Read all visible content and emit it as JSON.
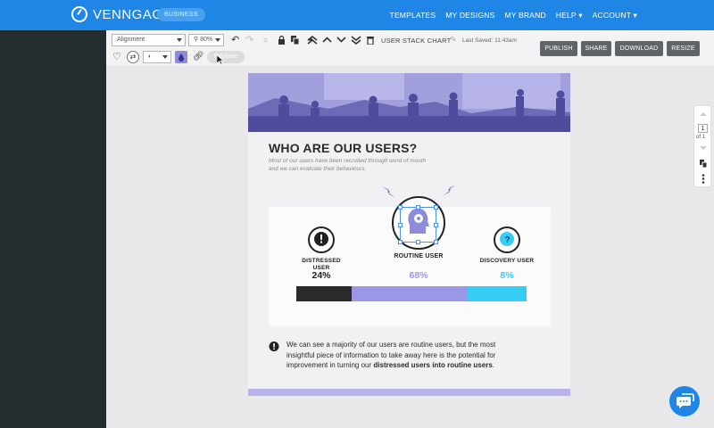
{
  "app": {
    "logo_text": "VENNGAGE",
    "plan_badge": "BUSINESS",
    "nav": [
      "TEMPLATES",
      "MY DESIGNS",
      "MY BRAND",
      "HELP ▾",
      "ACCOUNT ▾"
    ]
  },
  "toolbar": {
    "alignment_value": "Alignment",
    "zoom_value": "80%",
    "chart_title": "USER STACK CHART",
    "last_saved": "Last Saved: 11:43am",
    "publish_label": "PUBLISH",
    "share_label": "SHARE",
    "download_label": "DOWNLOAD",
    "resize_label": "RESIZE",
    "replace_label": "Replace"
  },
  "infographic": {
    "title": "WHO ARE OUR USERS?",
    "subtitle": "Most of our users have been recruited through word of mouth and we can evaluate their behaviours.",
    "segments": [
      {
        "label": "DISTRESSED USER",
        "value": "24%",
        "fraction": 0.24,
        "color": "#2a2a2a"
      },
      {
        "label": "ROUTINE USER",
        "value": "68%",
        "fraction": 0.5,
        "color": "#9a98e6"
      },
      {
        "label": "DISCOVERY USER",
        "value": "8%",
        "fraction": 0.26,
        "color": "#35cdf3"
      }
    ],
    "note_prefix": "We can see a majority of our users are routine users, but the most insightful piece of information to take away here is the potential for improvement in turning our ",
    "note_bold": "distressed users into routine users",
    "note_suffix": "."
  },
  "pager": {
    "current": "1",
    "of_text": "of 1"
  },
  "icons": [
    "logo-icon",
    "undo-icon",
    "redo-icon",
    "lock-icon",
    "duplicate-icon",
    "bring-front-icon",
    "move-up-icon",
    "move-down-icon",
    "send-back-icon",
    "trash-icon",
    "edit-icon",
    "heart-icon",
    "swap-icon",
    "contrast-icon",
    "fill-icon",
    "link-icon",
    "copy-page-icon",
    "more-icon",
    "chat-icon"
  ]
}
